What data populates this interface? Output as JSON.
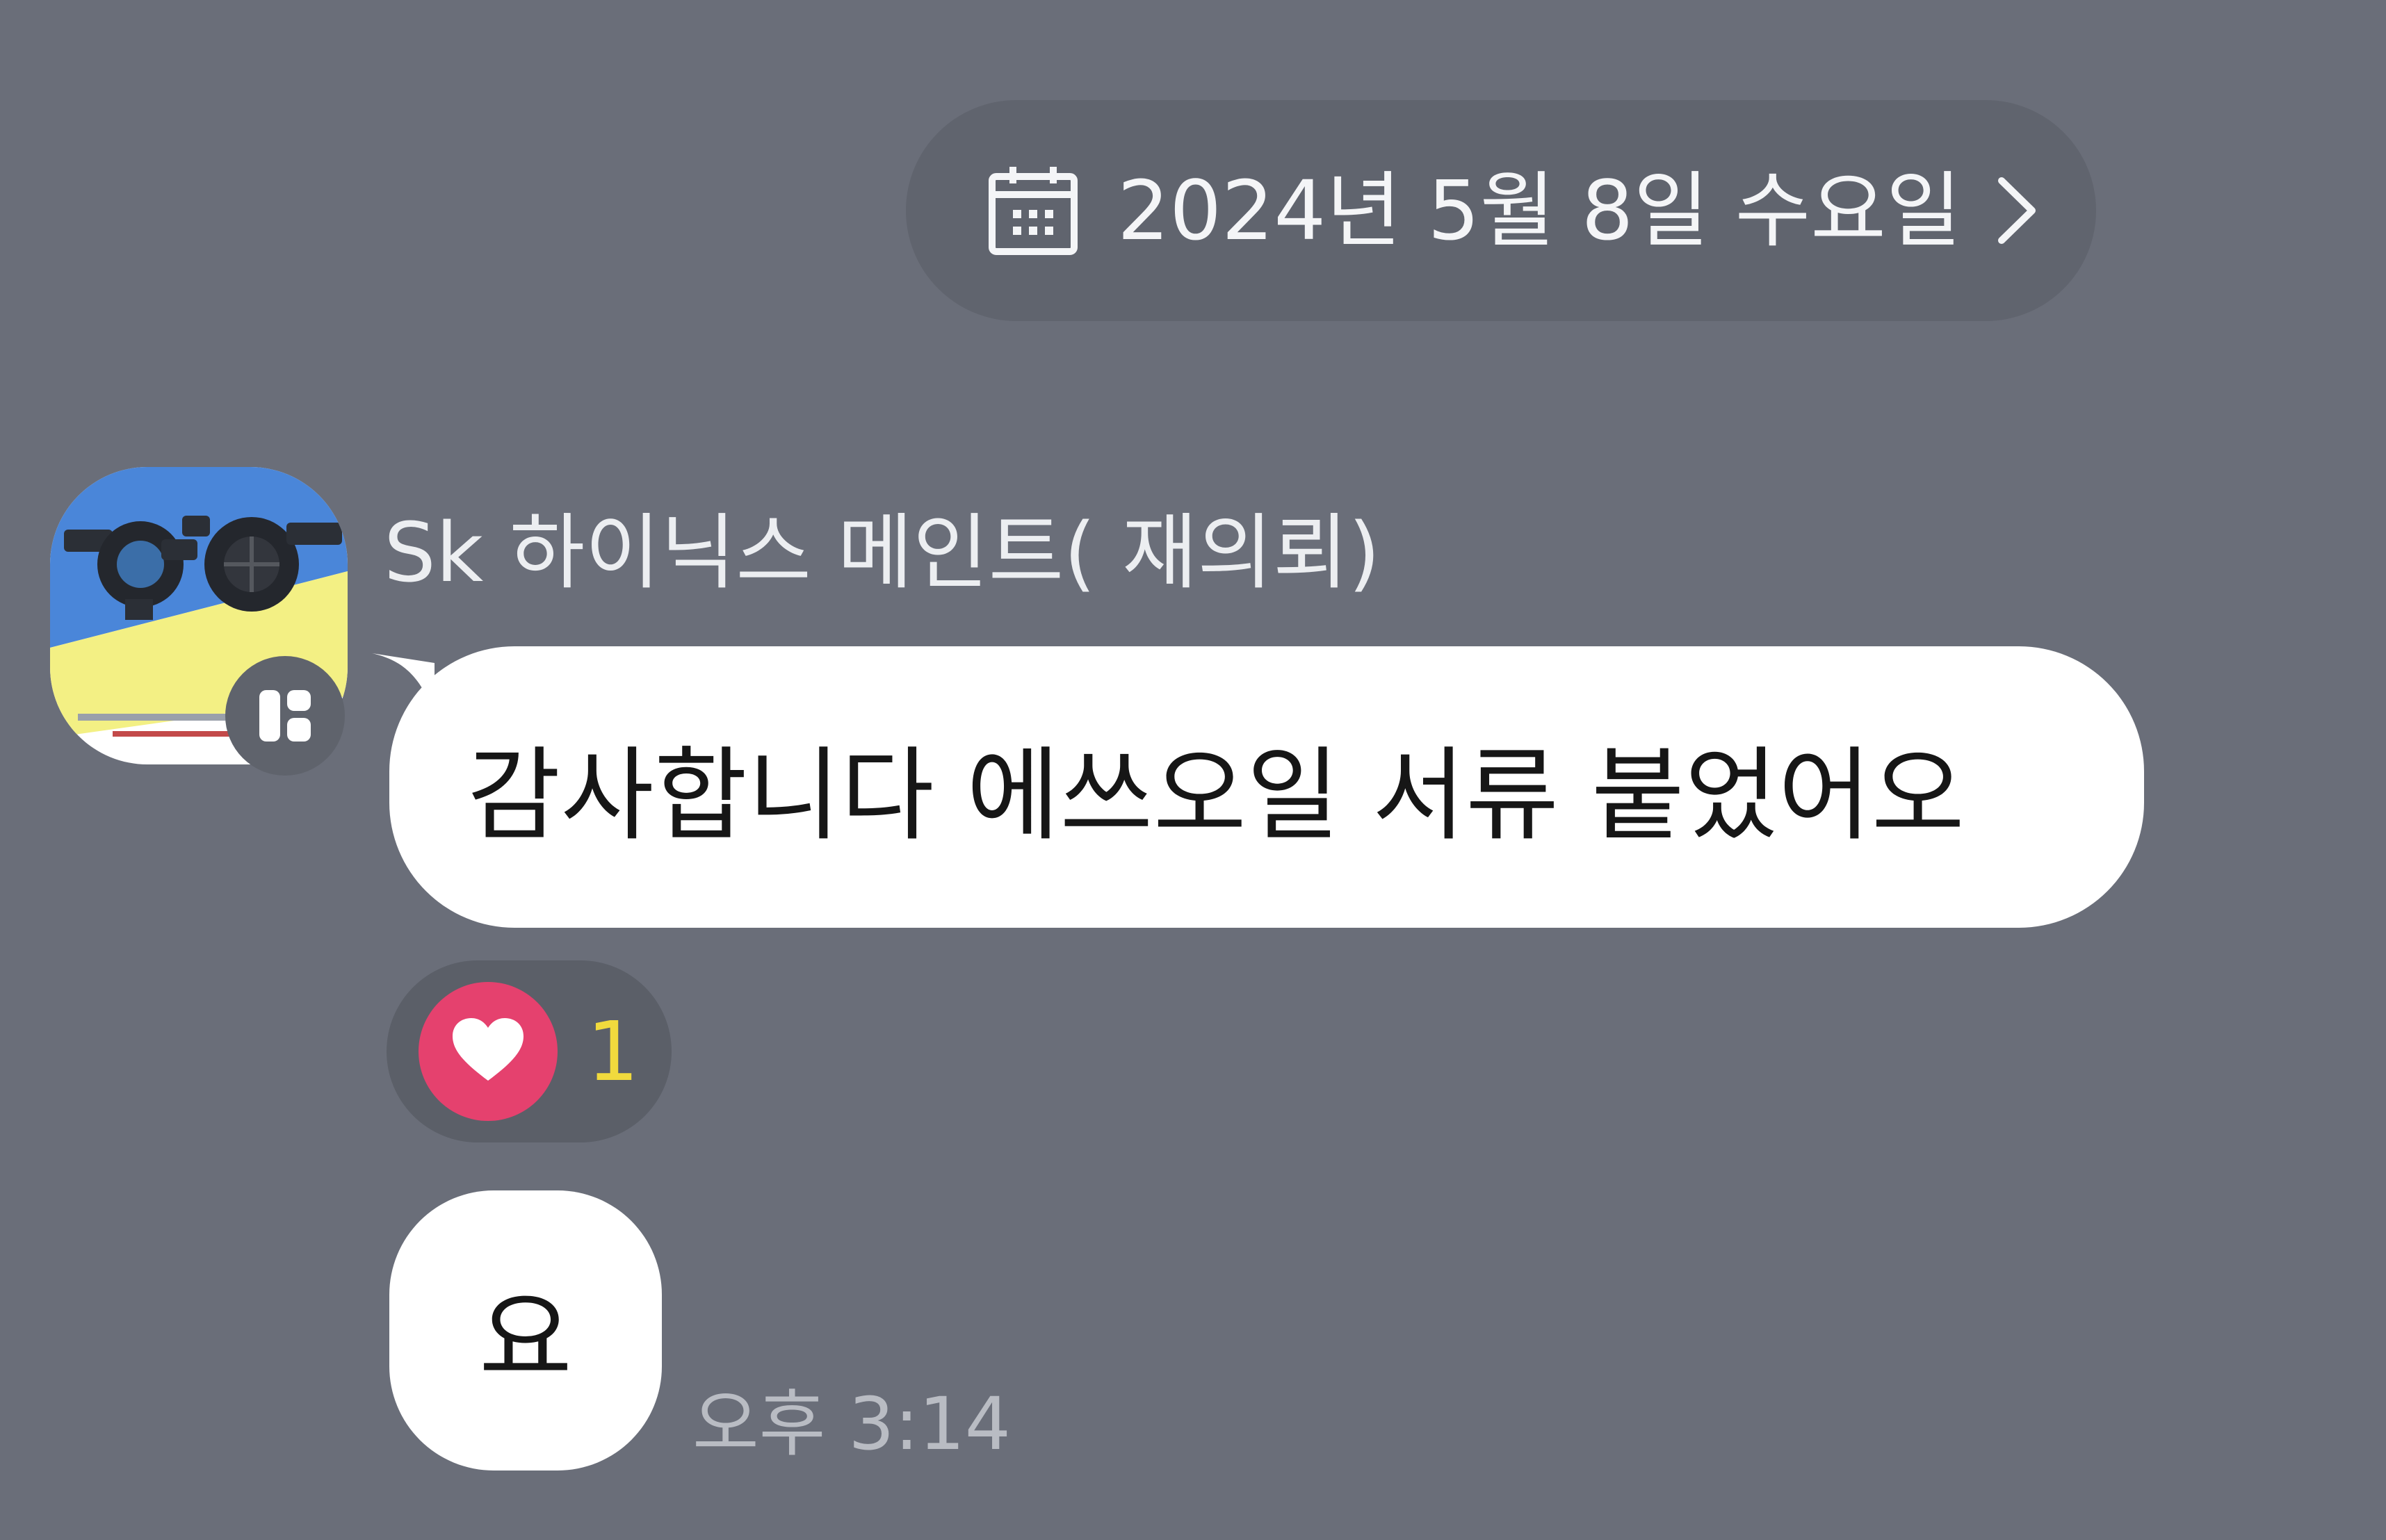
{
  "date_divider": {
    "label": "2024년 5월 8일 수요일",
    "icon": "calendar-icon",
    "chevron": "chevron-right-icon"
  },
  "sender": {
    "name": "Sk 하이닉스 메인트( 재의뢰)",
    "avatar_icon": "profile-photo",
    "badge_icon": "channel-badge-icon"
  },
  "messages": [
    {
      "text": "감사합니다 에쓰오일 서류 붙었어오"
    },
    {
      "text": "요",
      "time": "오후 3:14"
    }
  ],
  "reaction": {
    "icon": "heart-icon",
    "count": "1"
  },
  "colors": {
    "background": "#6a6e79",
    "pill": "#60646e",
    "bubble": "#ffffff",
    "heart": "#e5416e",
    "reaction_count": "#f1da3d"
  }
}
